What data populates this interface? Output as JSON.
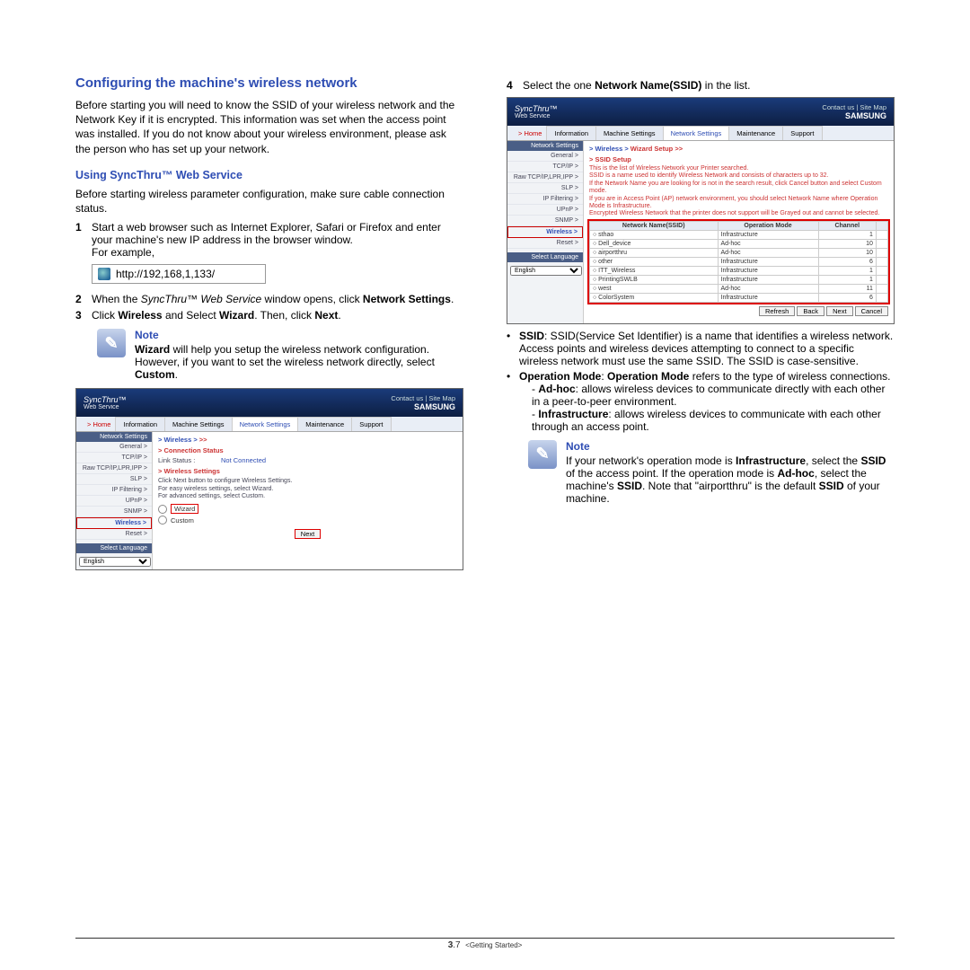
{
  "left": {
    "title": "Configuring the machine's wireless network",
    "intro": "Before starting you will need to know the SSID of your wireless network and the Network Key if it is encrypted. This information was set when the access point was installed. If you do not know about your wireless environment, please ask the person who has set up your network.",
    "sub_heading": "Using SyncThru™ Web Service",
    "sub_intro": "Before starting wireless parameter configuration, make sure cable connection status.",
    "step1_a": "Start a web browser such as Internet Explorer, Safari or Firefox and enter your machine's new IP address in the browser window.",
    "step1_b": "For example,",
    "url": "http://192,168,1,133/",
    "step2_a": "When the ",
    "step2_i": "SyncThru™ Web Service",
    "step2_b": " window opens, click ",
    "step2_c": "Network Settings",
    "step2_d": ".",
    "step3_a": "Click ",
    "step3_b": "Wireless",
    "step3_c": " and Select ",
    "step3_d": "Wizard",
    "step3_e": ". Then, click ",
    "step3_f": "Next",
    "step3_g": ".",
    "note_label": "Note",
    "note1_a": "Wizard",
    "note1_b": " will help you setup the wireless network configuration. However, if you want to set the wireless network directly, select ",
    "note1_c": "Custom",
    "note1_d": "."
  },
  "right": {
    "step4_a": "Select the one ",
    "step4_b": "Network Name(SSID)",
    "step4_c": " in the list.",
    "ssid_intro_a": "SSID",
    "ssid_intro_b": ": SSID(Service Set Identifier) is a name that identifies a wireless network. Access points and wireless devices attempting to connect to a specific wireless network must use the same SSID. The SSID is case-sensitive.",
    "op_a": "Operation Mode",
    "op_b": ": ",
    "op_c": "Operation Mode",
    "op_d": " refers to the type of wireless connections.",
    "adhoc_a": "Ad-hoc",
    "adhoc_b": ": allows wireless devices to communicate directly with each other in a peer-to-peer environment.",
    "infra_a": "Infrastructure",
    "infra_b": ": allows wireless devices to communicate with each other through an access point.",
    "note2_a": "If your network's operation mode is ",
    "note2_b": "Infrastructure",
    "note2_c": ", select the ",
    "note2_d": "SSID",
    "note2_e": " of the access point. If the operation mode is ",
    "note2_f": "Ad-hoc",
    "note2_g": ", select the machine's ",
    "note2_h": "SSID",
    "note2_i": ". Note that \"airportthru\" is the default ",
    "note2_j": "SSID",
    "note2_k": " of your machine.",
    "note_label": "Note"
  },
  "app1": {
    "title": "SyncThru™",
    "subtitle": "Web Service",
    "brand": "SAMSUNG",
    "meta": "Contact us  |  Site Map",
    "home": "> Home",
    "tabs": [
      "Information",
      "Machine Settings",
      "Network Settings",
      "Maintenance",
      "Support"
    ],
    "side_head": "Network Settings",
    "side": [
      "General >",
      "TCP/IP >",
      "Raw TCP/IP,LPR,IPP >",
      "SLP >",
      "IP Filtering >",
      "UPnP >",
      "SNMP >",
      "Wireless >",
      "Reset >"
    ],
    "side_label": "Select Language",
    "lang": "English",
    "crumb_pre": "> Wireless > ",
    "crumb_red": ">>",
    "sec1": "> Connection Status",
    "link_k": "Link Status :",
    "link_v": "Not Connected",
    "sec2": "> Wireless Settings",
    "blurb_a": "Click Next button to configure Wireless Settings.",
    "blurb_b": "For easy wireless settings, select Wizard.",
    "blurb_c": "For advanced settings, select Custom.",
    "opt_wizard": "Wizard",
    "opt_custom": "Custom",
    "next": "Next"
  },
  "app2": {
    "crumb_pre": "> Wireless > ",
    "crumb_red": "Wizard Setup >>",
    "sec": "> SSID Setup",
    "hint1": "This is the list of Wireless Network your Printer searched.",
    "hint2": "SSID is a name used to identify Wireless Network and consists of characters up to 32.",
    "hint3": "If the Network Name you are looking for is not in the search result, click Cancel button and select Custom mode.",
    "hint4": "If you are in Access Point (AP) network environment, you should select Network Name where Operation Mode is Infrastructure.",
    "hint5": "Encrypted Wireless Network that the printer does not support will be Grayed out and cannot be selected.",
    "th_name": "Network Name(SSID)",
    "th_mode": "Operation Mode",
    "th_ch": "Channel",
    "rows": [
      {
        "n": "sthao",
        "m": "Infrastructure",
        "c": "1"
      },
      {
        "n": "Dell_device",
        "m": "Ad-hoc",
        "c": "10"
      },
      {
        "n": "airportthru",
        "m": "Ad-hoc",
        "c": "10"
      },
      {
        "n": "other",
        "m": "Infrastructure",
        "c": "6"
      },
      {
        "n": "ITT_Wireless",
        "m": "Infrastructure",
        "c": "1"
      },
      {
        "n": "PrintingSWLB",
        "m": "Infrastructure",
        "c": "1"
      },
      {
        "n": "west",
        "m": "Ad-hoc",
        "c": "11"
      },
      {
        "n": "ColorSystem",
        "m": "Infrastructure",
        "c": "6"
      }
    ],
    "b_refresh": "Refresh",
    "b_back": "Back",
    "b_next": "Next",
    "b_cancel": "Cancel"
  },
  "footer": {
    "pg_major": "3",
    "pg_minor": ".7",
    "section": "<Getting Started>"
  }
}
